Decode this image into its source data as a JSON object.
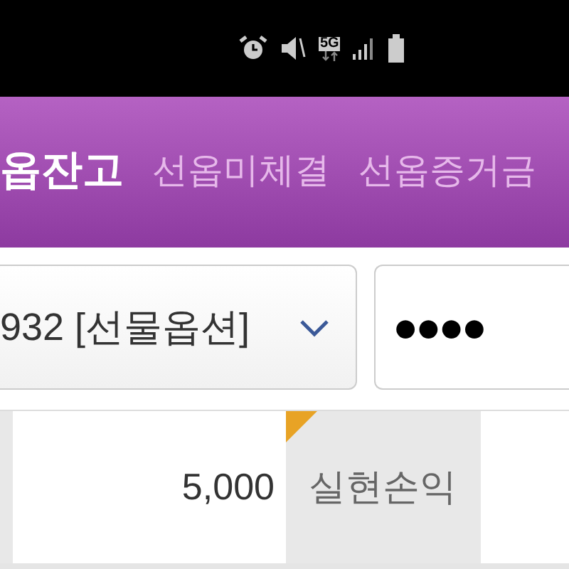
{
  "status_bar": {
    "network_label": "5G"
  },
  "tabs": [
    {
      "label": "옵잔고",
      "selected": true
    },
    {
      "label": "선옵미체결",
      "selected": false
    },
    {
      "label": "선옵증거금",
      "selected": false
    }
  ],
  "account": {
    "value": "932 [선물옵션]"
  },
  "password": {
    "value": "●●●●"
  },
  "summary_row": {
    "value": "5,000",
    "label": "실현손익",
    "label_flagged": true
  }
}
